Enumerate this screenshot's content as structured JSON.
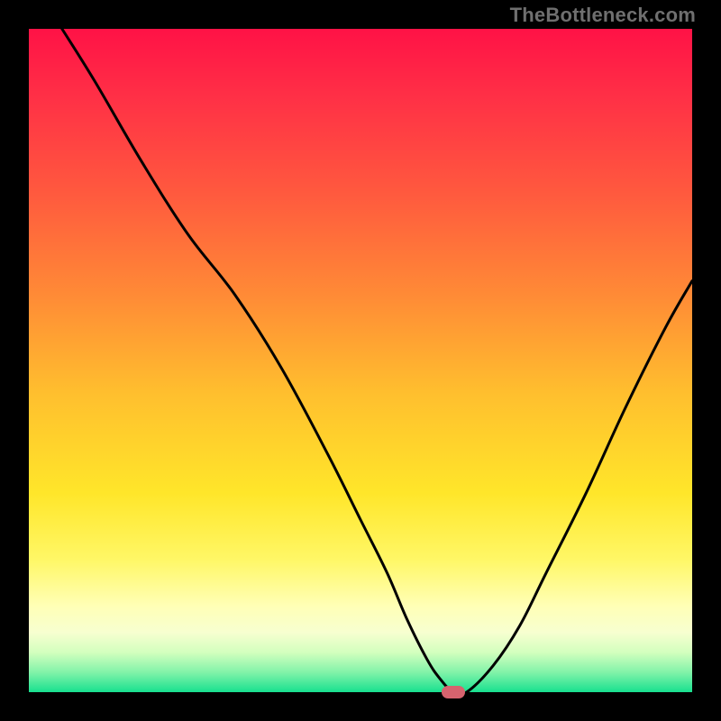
{
  "watermark": "TheBottleneck.com",
  "chart_data": {
    "type": "line",
    "title": "",
    "xlabel": "",
    "ylabel": "",
    "xlim": [
      0,
      100
    ],
    "ylim": [
      0,
      100
    ],
    "grid": false,
    "legend": false,
    "gradient_stops": [
      {
        "offset": 0.0,
        "color": "#ff1246"
      },
      {
        "offset": 0.1,
        "color": "#ff2f46"
      },
      {
        "offset": 0.25,
        "color": "#ff5a3e"
      },
      {
        "offset": 0.4,
        "color": "#ff8a36"
      },
      {
        "offset": 0.55,
        "color": "#ffbf2e"
      },
      {
        "offset": 0.7,
        "color": "#ffe62a"
      },
      {
        "offset": 0.8,
        "color": "#fff766"
      },
      {
        "offset": 0.87,
        "color": "#ffffb6"
      },
      {
        "offset": 0.91,
        "color": "#f7ffd0"
      },
      {
        "offset": 0.94,
        "color": "#d3ffbe"
      },
      {
        "offset": 0.97,
        "color": "#82f3a9"
      },
      {
        "offset": 1.0,
        "color": "#18e08f"
      }
    ],
    "series": [
      {
        "name": "bottleneck-curve",
        "color": "#000000",
        "x": [
          5,
          10,
          17,
          24,
          31,
          38,
          45,
          50,
          54,
          57,
          60,
          62,
          64,
          66,
          70,
          74,
          78,
          84,
          90,
          96,
          100
        ],
        "values": [
          100,
          92,
          80,
          69,
          60,
          49,
          36,
          26,
          18,
          11,
          5,
          2,
          0,
          0,
          4,
          10,
          18,
          30,
          43,
          55,
          62
        ]
      }
    ],
    "marker": {
      "x": 64,
      "y": 0,
      "color": "#d6636e",
      "shape": "pill"
    }
  }
}
